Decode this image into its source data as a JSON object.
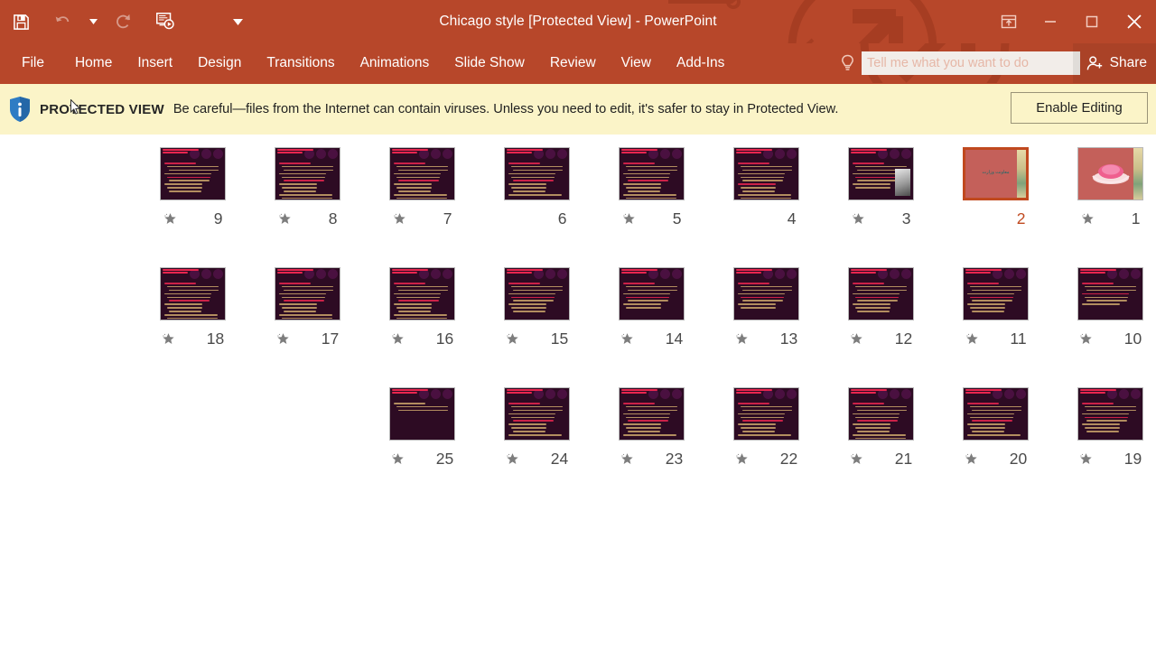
{
  "window": {
    "title": "Chicago style [Protected View] - PowerPoint",
    "quick_access": [
      {
        "name": "save",
        "icon": "save-icon"
      },
      {
        "name": "undo",
        "icon": "undo-icon"
      },
      {
        "name": "redo",
        "icon": "redo-icon"
      },
      {
        "name": "start-from-beginning",
        "icon": "slideshow-icon"
      },
      {
        "name": "customize-quick-access",
        "icon": "chevron-down-icon"
      }
    ],
    "controls": [
      {
        "name": "ribbon-display-options",
        "icon": "ribbon-options-icon"
      },
      {
        "name": "minimize",
        "icon": "minimize-icon",
        "glyph": "—"
      },
      {
        "name": "restore",
        "icon": "restore-icon",
        "glyph": "▭"
      },
      {
        "name": "close",
        "icon": "close-icon",
        "glyph": "✕"
      }
    ]
  },
  "ribbon": {
    "tabs": [
      {
        "label": "File"
      },
      {
        "label": "Home"
      },
      {
        "label": "Insert"
      },
      {
        "label": "Design"
      },
      {
        "label": "Transitions"
      },
      {
        "label": "Animations"
      },
      {
        "label": "Slide Show"
      },
      {
        "label": "Review"
      },
      {
        "label": "View"
      },
      {
        "label": "Add-Ins"
      }
    ],
    "tellme_placeholder": "Tell me what you want to do",
    "share_label": "Share"
  },
  "protected_view": {
    "badge": "PROTECTED VIEW",
    "message": "Be careful—files from the Internet can contain viruses. Unless you need to edit, it's safer to stay in Protected View.",
    "enable_button": "Enable Editing"
  },
  "colors": {
    "ribbon": "#b7472a",
    "notification_bar": "#fbf4c8",
    "selection": "#c0491f",
    "slide_dark": "#2d0b23",
    "slide_accent": "#caa46a",
    "title_slide_bg": "#c4605a"
  },
  "slide_sorter": {
    "rows": [
      {
        "row": 1,
        "slides": [
          {
            "number": "9",
            "col": 1,
            "star": true,
            "selected": false,
            "style": "dark-text",
            "lines": 9
          },
          {
            "number": "8",
            "col": 2,
            "star": true,
            "selected": false,
            "style": "dark-text",
            "lines": 11
          },
          {
            "number": "7",
            "col": 3,
            "star": true,
            "selected": false,
            "style": "dark-text",
            "lines": 11
          },
          {
            "number": "6",
            "col": 4,
            "star": false,
            "selected": false,
            "style": "dark-text",
            "lines": 10
          },
          {
            "number": "5",
            "col": 5,
            "star": true,
            "selected": false,
            "style": "dark-text",
            "lines": 11
          },
          {
            "number": "4",
            "col": 6,
            "star": false,
            "selected": false,
            "style": "dark-text",
            "lines": 12
          },
          {
            "number": "3",
            "col": 7,
            "star": true,
            "selected": false,
            "style": "dark-portrait",
            "lines": 8
          },
          {
            "number": "2",
            "col": 8,
            "star": false,
            "selected": true,
            "style": "title-salmon",
            "title": "معاونت وزارت"
          },
          {
            "number": "1",
            "col": 9,
            "star": true,
            "selected": false,
            "style": "title-flower"
          }
        ]
      },
      {
        "row": 2,
        "slides": [
          {
            "number": "18",
            "col": 1,
            "star": true,
            "selected": false,
            "style": "dark-text",
            "lines": 11
          },
          {
            "number": "17",
            "col": 2,
            "star": true,
            "selected": false,
            "style": "dark-text",
            "lines": 11
          },
          {
            "number": "16",
            "col": 3,
            "star": true,
            "selected": false,
            "style": "dark-text",
            "lines": 11
          },
          {
            "number": "15",
            "col": 4,
            "star": true,
            "selected": false,
            "style": "dark-text",
            "lines": 9
          },
          {
            "number": "14",
            "col": 5,
            "star": true,
            "selected": false,
            "style": "dark-text",
            "lines": 8
          },
          {
            "number": "13",
            "col": 6,
            "star": true,
            "selected": false,
            "style": "dark-text",
            "lines": 8
          },
          {
            "number": "12",
            "col": 7,
            "star": true,
            "selected": false,
            "style": "dark-text",
            "lines": 9
          },
          {
            "number": "11",
            "col": 8,
            "star": true,
            "selected": false,
            "style": "dark-text",
            "lines": 9
          },
          {
            "number": "10",
            "col": 9,
            "star": true,
            "selected": false,
            "style": "dark-text",
            "lines": 7
          }
        ]
      },
      {
        "row": 3,
        "slides": [
          {
            "number": "25",
            "col": 3,
            "star": true,
            "selected": false,
            "style": "dark-text",
            "lines": 3
          },
          {
            "number": "24",
            "col": 4,
            "star": true,
            "selected": false,
            "style": "dark-text",
            "lines": 10
          },
          {
            "number": "23",
            "col": 5,
            "star": true,
            "selected": false,
            "style": "dark-text",
            "lines": 10
          },
          {
            "number": "22",
            "col": 6,
            "star": true,
            "selected": false,
            "style": "dark-text",
            "lines": 10
          },
          {
            "number": "21",
            "col": 7,
            "star": true,
            "selected": false,
            "style": "dark-text",
            "lines": 11
          },
          {
            "number": "20",
            "col": 8,
            "star": true,
            "selected": false,
            "style": "dark-text",
            "lines": 10
          },
          {
            "number": "19",
            "col": 9,
            "star": true,
            "selected": false,
            "style": "dark-text",
            "lines": 9
          }
        ]
      }
    ]
  }
}
